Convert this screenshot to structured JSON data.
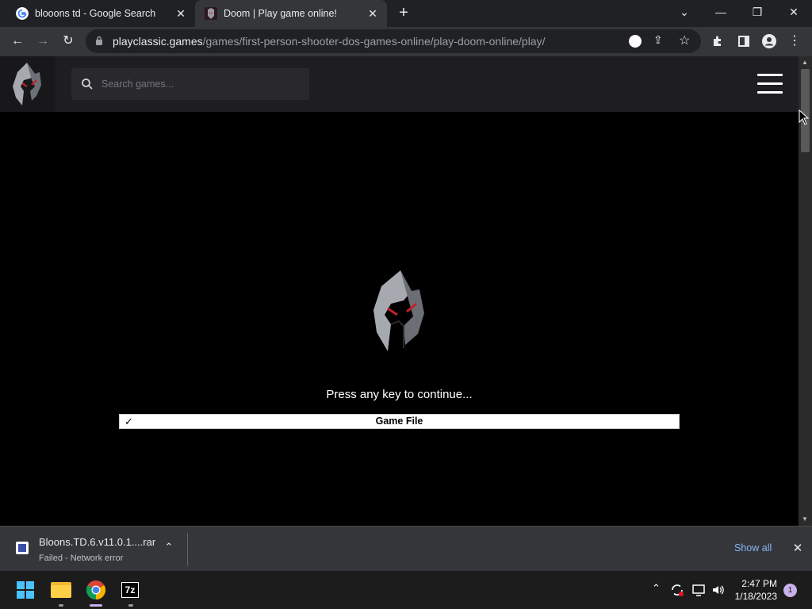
{
  "browser": {
    "tabs": [
      {
        "title": "blooons td - Google Search"
      },
      {
        "title": "Doom | Play game online!"
      }
    ],
    "url_domain": "playclassic.games",
    "url_path": "/games/first-person-shooter-dos-games-online/play-doom-online/play/"
  },
  "site": {
    "search_placeholder": "Search games..."
  },
  "game": {
    "prompt": "Press any key to continue...",
    "file_check": "✓",
    "file_label": "Game File"
  },
  "download": {
    "file_name": "Bloons.TD.6.v11.0.1....rar",
    "status": "Failed - Network error",
    "show_all": "Show all"
  },
  "taskbar": {
    "time": "2:47 PM",
    "date": "1/18/2023",
    "notification_count": "1"
  },
  "colors": {
    "tabstrip": "#202124",
    "toolbar": "#35363a",
    "header": "#1e1e22",
    "accent_red": "#c8202a"
  }
}
